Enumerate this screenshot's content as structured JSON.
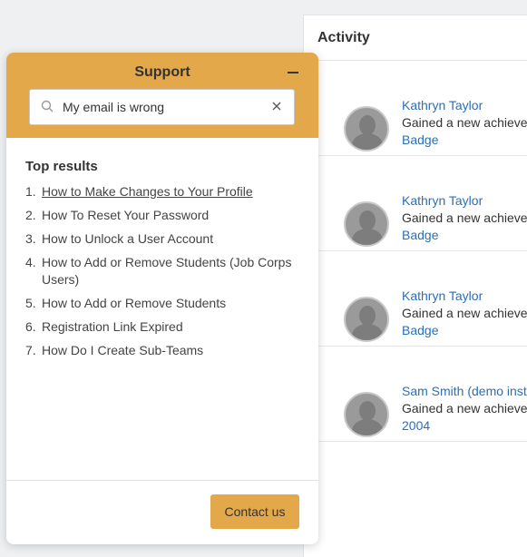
{
  "activity": {
    "title": "Activity",
    "items": [
      {
        "name": "Kathryn Taylor",
        "desc": "Gained a new achiever",
        "link": "Badge"
      },
      {
        "name": "Kathryn Taylor",
        "desc": "Gained a new achiever",
        "link": "Badge"
      },
      {
        "name": "Kathryn Taylor",
        "desc": "Gained a new achiever",
        "link": "Badge"
      },
      {
        "name": "Sam Smith (demo instr",
        "desc": "Gained a new achiever",
        "link": "2004"
      }
    ]
  },
  "support": {
    "title": "Support",
    "search": {
      "value": "My email is wrong"
    },
    "results_title": "Top results",
    "results": [
      {
        "num": "1.",
        "label": "How to Make Changes to Your Profile"
      },
      {
        "num": "2.",
        "label": "How To Reset Your Password"
      },
      {
        "num": "3.",
        "label": "How to Unlock a User Account"
      },
      {
        "num": "4.",
        "label": "How to Add or Remove Students (Job Corps Users)"
      },
      {
        "num": "5.",
        "label": "How to Add or Remove Students"
      },
      {
        "num": "6.",
        "label": "Registration Link Expired"
      },
      {
        "num": "7.",
        "label": "How Do I Create Sub-Teams"
      }
    ],
    "contact_label": "Contact us"
  },
  "colors": {
    "accent": "#e3a84a",
    "link": "#2a6fba"
  },
  "icons": [
    "search-icon",
    "close-icon",
    "minimize-icon",
    "user-avatar-icon"
  ]
}
